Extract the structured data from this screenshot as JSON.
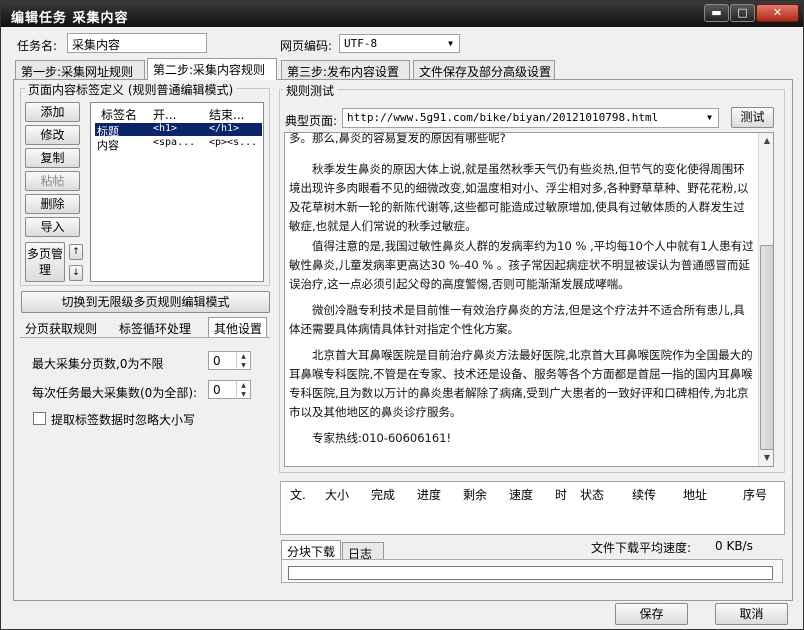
{
  "window": {
    "title": "编辑任务 采集内容",
    "min": "▬",
    "max": "□",
    "close": "✕"
  },
  "task": {
    "label": "任务名:",
    "value": "采集内容"
  },
  "encoding": {
    "label": "网页编码:",
    "value": "UTF-8"
  },
  "tabs": [
    "第一步:采集网址规则",
    "第二步:采集内容规则",
    "第三步:发布内容设置",
    "文件保存及部分高级设置"
  ],
  "left": {
    "group_title": "页面内容标签定义 (规则普通编辑模式)",
    "buttons": {
      "add": "添加",
      "edit": "修改",
      "copy": "复制",
      "paste": "粘帖",
      "delete": "删除",
      "import": "导入",
      "multipage": "多页管理"
    },
    "table": {
      "headers": [
        "标签名",
        "开...",
        "结束..."
      ],
      "rows": [
        [
          "标题",
          "<h1>",
          "</h1>"
        ],
        [
          "内容",
          "<spa...",
          "<p><s..."
        ]
      ]
    },
    "switch_button": "切换到无限级多页规则编辑模式",
    "subtabs": [
      "分页获取规则",
      "标签循环处理",
      "其他设置"
    ],
    "max_pages_label": "最大采集分页数,0为不限",
    "max_pages_value": "0",
    "max_items_label": "每次任务最大采集数(0为全部):",
    "max_items_value": "0",
    "ignore_case_label": "提取标签数据时忽略大小写"
  },
  "right": {
    "group_title": "规则测试",
    "typical_label": "典型页面:",
    "typical_url": "http://www.5g91.com/bike/biyan/20121010798.html",
    "test_button": "测试",
    "article": [
      "多。那么,鼻炎的容易复发的原因有哪些呢?",
      "　　秋季发生鼻炎的原因大体上说,就是虽然秋季天气仍有些炎热,但节气的变化使得周围环境出现许多肉眼看不见的细微改变,如温度相对小、浮尘相对多,各种野草草种、野花花粉,以及花草树木新一轮的新陈代谢等,这些都可能造成过敏原增加,使具有过敏体质的人群发生过敏症,也就是人们常说的秋季过敏症。",
      "　　值得注意的是,我国过敏性鼻炎人群的发病率约为10 % ,平均每10个人中就有1人患有过敏性鼻炎,儿童发病率更高达30 %-40 % 。孩子常因起病症状不明显被误认为普通感冒而延误治疗,这一点必须引起父母的高度警惕,否则可能渐渐发展成哮喘。",
      "　　微创冷融专利技术是目前惟一有效治疗鼻炎的方法,但是这个疗法并不适合所有患儿,具体还需要具体病情具体针对指定个性化方案。",
      "　　北京首大耳鼻喉医院是目前治疗鼻炎方法最好医院,北京首大耳鼻喉医院作为全国最大的耳鼻喉专科医院,不管是在专家、技术还是设备、服务等各个方面都是首屈一指的国内耳鼻喉专科医院,且为数以万计的鼻炎患者解除了病痛,受到广大患者的一致好评和口碑相传,为北京市以及其他地区的鼻炎诊疗服务。",
      "　　专家热线:010-60606161!"
    ],
    "download_headers": [
      "文.",
      "大小",
      "完成",
      "进度",
      "剩余",
      "速度",
      "时",
      "状态",
      "续传",
      "地址",
      "序号"
    ],
    "bottom_tabs": [
      "分块下载",
      "日志"
    ],
    "speed_label": "文件下载平均速度:",
    "speed_value": "0 KB/s"
  },
  "footer": {
    "save": "保存",
    "cancel": "取消"
  }
}
